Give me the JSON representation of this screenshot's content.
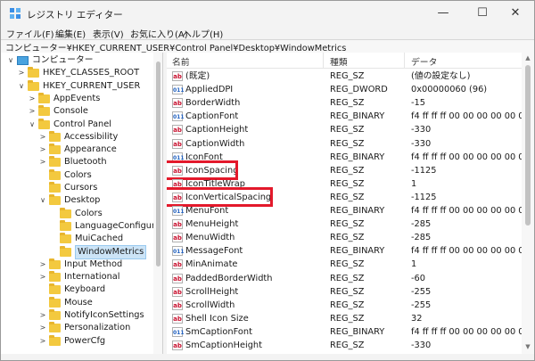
{
  "window": {
    "title": "レジストリ エディター",
    "minimize": "—",
    "maximize": "☐",
    "close": "✕"
  },
  "menu": [
    "ファイル(F)",
    "編集(E)",
    "表示(V)",
    "お気に入り(A)",
    "ヘルプ(H)"
  ],
  "address": "コンピューター¥HKEY_CURRENT_USER¥Control Panel¥Desktop¥WindowMetrics",
  "tree": {
    "items": [
      {
        "label": "コンピューター",
        "arrow": "∨",
        "kind": "pc"
      },
      {
        "label": "HKEY_CLASSES_ROOT",
        "arrow": ">",
        "kind": "folder"
      },
      {
        "label": "HKEY_CURRENT_USER",
        "arrow": "∨",
        "kind": "folder"
      },
      {
        "label": "AppEvents",
        "arrow": ">",
        "kind": "folder"
      },
      {
        "label": "Console",
        "arrow": ">",
        "kind": "folder"
      },
      {
        "label": "Control Panel",
        "arrow": "∨",
        "kind": "folder"
      },
      {
        "label": "Accessibility",
        "arrow": ">",
        "kind": "folder"
      },
      {
        "label": "Appearance",
        "arrow": ">",
        "kind": "folder"
      },
      {
        "label": "Bluetooth",
        "arrow": ">",
        "kind": "folder"
      },
      {
        "label": "Colors",
        "arrow": "",
        "kind": "folder"
      },
      {
        "label": "Cursors",
        "arrow": "",
        "kind": "folder"
      },
      {
        "label": "Desktop",
        "arrow": "∨",
        "kind": "folder"
      },
      {
        "label": "Colors",
        "arrow": "",
        "kind": "folder"
      },
      {
        "label": "LanguageConfigura",
        "arrow": "",
        "kind": "folder"
      },
      {
        "label": "MuiCached",
        "arrow": "",
        "kind": "folder"
      },
      {
        "label": "WindowMetrics",
        "arrow": "",
        "kind": "folder",
        "selected": true
      },
      {
        "label": "Input Method",
        "arrow": ">",
        "kind": "folder"
      },
      {
        "label": "International",
        "arrow": ">",
        "kind": "folder"
      },
      {
        "label": "Keyboard",
        "arrow": "",
        "kind": "folder"
      },
      {
        "label": "Mouse",
        "arrow": "",
        "kind": "folder"
      },
      {
        "label": "NotifyIconSettings",
        "arrow": ">",
        "kind": "folder"
      },
      {
        "label": "Personalization",
        "arrow": ">",
        "kind": "folder"
      },
      {
        "label": "PowerCfg",
        "arrow": ">",
        "kind": "folder"
      }
    ]
  },
  "list": {
    "headers": {
      "name": "名前",
      "type": "種類",
      "data": "データ"
    },
    "rows": [
      {
        "name": "(既定)",
        "type": "REG_SZ",
        "data": "(値の設定なし)",
        "icon": "ab"
      },
      {
        "name": "AppliedDPI",
        "type": "REG_DWORD",
        "data": "0x00000060 (96)",
        "icon": "bin"
      },
      {
        "name": "BorderWidth",
        "type": "REG_SZ",
        "data": "-15",
        "icon": "ab"
      },
      {
        "name": "CaptionFont",
        "type": "REG_BINARY",
        "data": "f4 ff ff ff 00 00 00 00 00 00 0",
        "icon": "bin"
      },
      {
        "name": "CaptionHeight",
        "type": "REG_SZ",
        "data": "-330",
        "icon": "ab"
      },
      {
        "name": "CaptionWidth",
        "type": "REG_SZ",
        "data": "-330",
        "icon": "ab"
      },
      {
        "name": "IconFont",
        "type": "REG_BINARY",
        "data": "f4 ff ff ff 00 00 00 00 00 00 0",
        "icon": "bin"
      },
      {
        "name": "IconSpacing",
        "type": "REG_SZ",
        "data": "-1125",
        "icon": "ab",
        "highlight": true
      },
      {
        "name": "IconTitleWrap",
        "type": "REG_SZ",
        "data": "1",
        "icon": "ab"
      },
      {
        "name": "IconVerticalSpacing",
        "type": "REG_SZ",
        "data": "-1125",
        "icon": "ab",
        "highlight": true
      },
      {
        "name": "MenuFont",
        "type": "REG_BINARY",
        "data": "f4 ff ff ff 00 00 00 00 00 00 0",
        "icon": "bin"
      },
      {
        "name": "MenuHeight",
        "type": "REG_SZ",
        "data": "-285",
        "icon": "ab"
      },
      {
        "name": "MenuWidth",
        "type": "REG_SZ",
        "data": "-285",
        "icon": "ab"
      },
      {
        "name": "MessageFont",
        "type": "REG_BINARY",
        "data": "f4 ff ff ff 00 00 00 00 00 00 0",
        "icon": "bin"
      },
      {
        "name": "MinAnimate",
        "type": "REG_SZ",
        "data": "1",
        "icon": "ab"
      },
      {
        "name": "PaddedBorderWidth",
        "type": "REG_SZ",
        "data": "-60",
        "icon": "ab"
      },
      {
        "name": "ScrollHeight",
        "type": "REG_SZ",
        "data": "-255",
        "icon": "ab"
      },
      {
        "name": "ScrollWidth",
        "type": "REG_SZ",
        "data": "-255",
        "icon": "ab"
      },
      {
        "name": "Shell Icon Size",
        "type": "REG_SZ",
        "data": "32",
        "icon": "ab"
      },
      {
        "name": "SmCaptionFont",
        "type": "REG_BINARY",
        "data": "f4 ff ff ff 00 00 00 00 00 00 0",
        "icon": "bin"
      },
      {
        "name": "SmCaptionHeight",
        "type": "REG_SZ",
        "data": "-330",
        "icon": "ab"
      }
    ]
  },
  "colors": {
    "highlight": "#e3192b",
    "selection": "#cce4f7",
    "folder": "#f3c93f"
  }
}
